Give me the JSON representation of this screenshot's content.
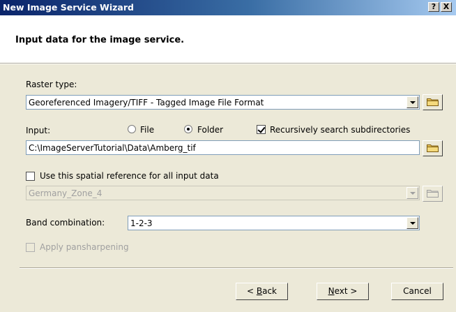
{
  "window": {
    "title": "New Image Service Wizard",
    "help_label": "?",
    "close_label": "X"
  },
  "header": {
    "title": "Input data for the image service."
  },
  "raster_type": {
    "label": "Raster type:",
    "value": "Georeferenced Imagery/TIFF - Tagged Image File Format"
  },
  "input": {
    "label": "Input:",
    "options": [
      "File",
      "Folder"
    ],
    "selected": "Folder",
    "recursive_label": "Recursively search subdirectories",
    "recursive_checked": true,
    "path": "C:\\ImageServerTutorial\\Data\\Amberg_tif"
  },
  "spatial_reference": {
    "checkbox_label": "Use this spatial reference for all input data",
    "checked": false,
    "value": "Germany_Zone_4"
  },
  "band": {
    "label": "Band combination:",
    "value": "1-2-3"
  },
  "pansharpening": {
    "label": "Apply pansharpening",
    "checked": false,
    "enabled": false
  },
  "buttons": {
    "back_prefix": "< ",
    "back_key": "B",
    "back_rest": "ack",
    "next_key": "N",
    "next_rest": "ext >",
    "cancel": "Cancel"
  },
  "colors": {
    "titlebar_start": "#0a246a",
    "titlebar_end": "#a6caf0",
    "dialog_bg": "#ece9d8"
  }
}
